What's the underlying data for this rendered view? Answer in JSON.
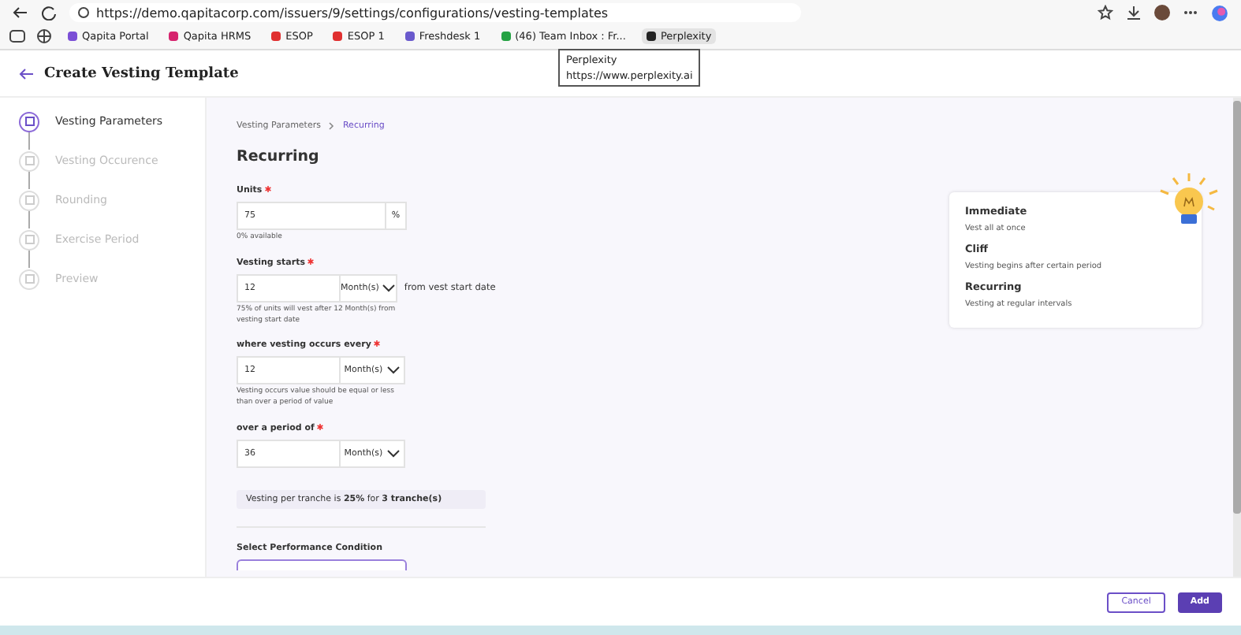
{
  "browser": {
    "url": "https://demo.qapitacorp.com/issuers/9/settings/configurations/vesting-templates",
    "bookmarks": [
      {
        "label": "Qapita Portal",
        "color": "#7b4fd6"
      },
      {
        "label": "Qapita HRMS",
        "color": "#d6246e"
      },
      {
        "label": "ESOP",
        "color": "#e03030"
      },
      {
        "label": "ESOP 1",
        "color": "#e03030"
      },
      {
        "label": "Freshdesk 1",
        "color": "#6a5acd"
      },
      {
        "label": "(46) Team Inbox : Fr...",
        "color": "#25a244"
      },
      {
        "label": "Perplexity",
        "color": "#222222"
      }
    ],
    "tooltip": {
      "title": "Perplexity",
      "url": "https://www.perplexity.ai"
    }
  },
  "page": {
    "title": "Create Vesting Template"
  },
  "steps": [
    {
      "label": "Vesting Parameters",
      "active": true
    },
    {
      "label": "Vesting Occurence",
      "active": false
    },
    {
      "label": "Rounding",
      "active": false
    },
    {
      "label": "Exercise Period",
      "active": false
    },
    {
      "label": "Preview",
      "active": false
    }
  ],
  "breadcrumb": [
    "Vesting Parameters",
    "Recurring"
  ],
  "heading": "Recurring",
  "fields": [
    {
      "kind": "suffix",
      "label": "Units",
      "required": true,
      "value": "75",
      "unit": "%",
      "help": "0% available"
    },
    {
      "kind": "select",
      "label": "Vesting starts",
      "required": true,
      "value": "12",
      "unit": "Month(s)",
      "help": "75% of units will vest after 12 Month(s) from vesting start date",
      "after": "from vest start date"
    },
    {
      "kind": "select",
      "label": "where vesting occurs every",
      "required": true,
      "value": "12",
      "unit": "Month(s)",
      "help": "Vesting occurs value should be equal or less than over a period of value"
    },
    {
      "kind": "select",
      "label": "over a period of",
      "required": true,
      "value": "36",
      "unit": "Month(s)"
    }
  ],
  "summary": "Vesting per tranche is **25%** for **3 tranche(s)**",
  "performance_label": "Select Performance Condition",
  "info": [
    {
      "title": "Immediate",
      "text": "Vest all at once"
    },
    {
      "title": "Cliff",
      "text": "Vesting begins after certain period"
    },
    {
      "title": "Recurring",
      "text": "Vesting at regular intervals"
    }
  ],
  "buttons": {
    "cancel": "Cancel",
    "add": "Add"
  }
}
